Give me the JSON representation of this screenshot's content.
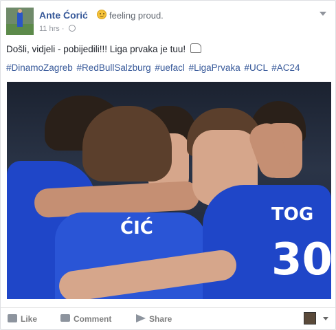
{
  "post": {
    "author": "Ante Ćorić",
    "feeling": "feeling proud.",
    "time": "11 hrs",
    "separator": "·",
    "text": "Došli, vidjeli - pobijedili!!! Liga prvaka je tuu!",
    "hashtags": "#DinamoZagreb #RedBullSalzburg #uefacl #LigaPrvaka #UCL #AC24",
    "jersey_numbers": {
      "left_back": "ĆIĆ",
      "right": "TOG",
      "right_number": "30"
    }
  },
  "actions": {
    "like_label": "Like",
    "comment_label": "Comment",
    "share_label": "Share"
  },
  "icons": [
    "smile-emoji-icon",
    "globe-icon",
    "chevron-down-icon",
    "flexed-biceps-icon",
    "like-icon",
    "comment-icon",
    "share-icon"
  ],
  "colors": {
    "link": "#365899",
    "jersey": "#1f46c8"
  }
}
